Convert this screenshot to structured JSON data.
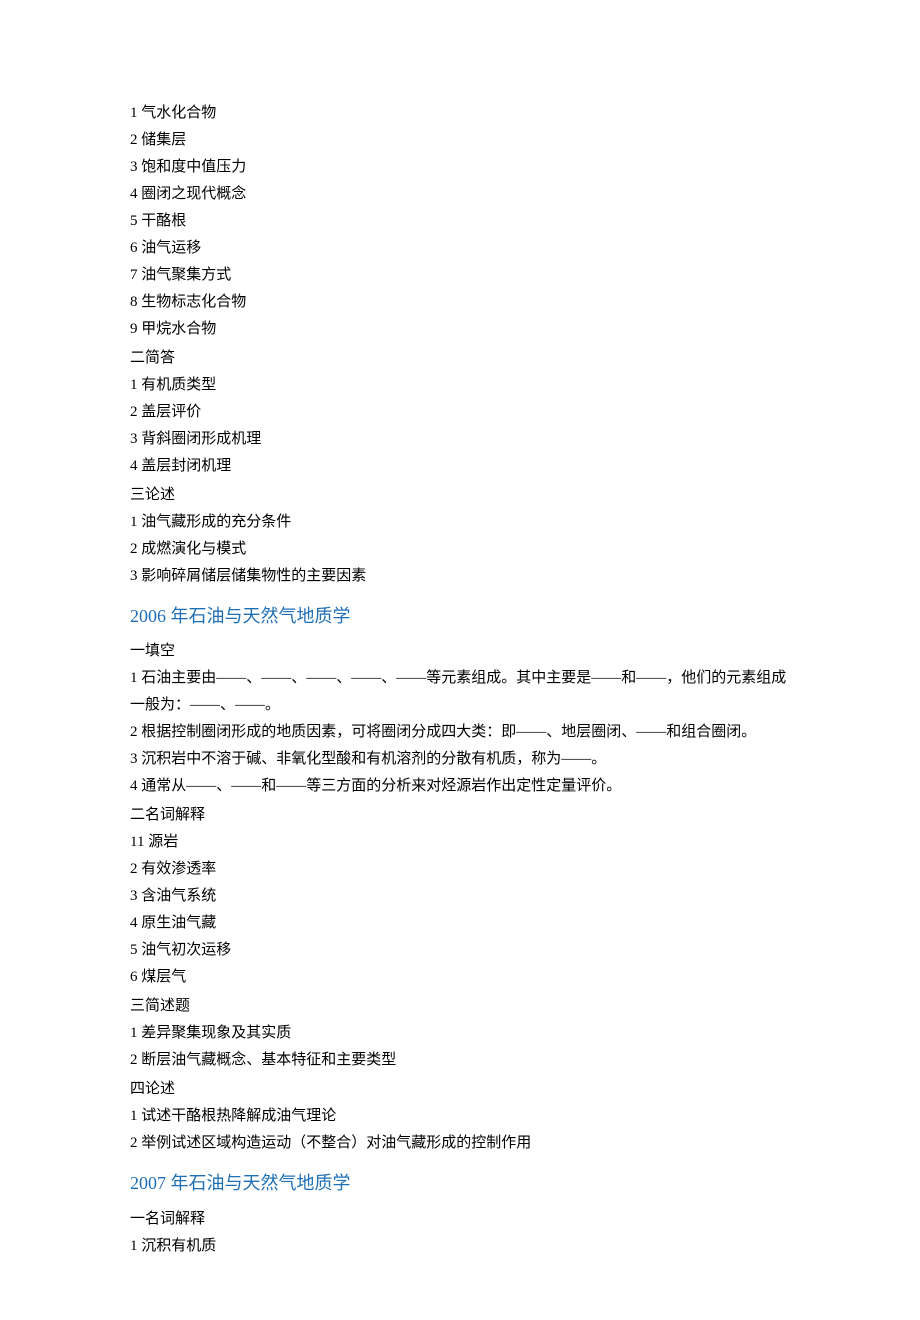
{
  "block1": {
    "items": [
      "1 气水化合物",
      "2 储集层",
      "3 饱和度中值压力",
      "4 圈闭之现代概念",
      "5 干酪根",
      "6 油气运移",
      "7 油气聚集方式",
      "8 生物标志化合物",
      "9 甲烷水合物"
    ],
    "subhead2": "二简答",
    "items2": [
      "1 有机质类型",
      "2 盖层评价",
      "3 背斜圈闭形成机理",
      "4 盖层封闭机理"
    ],
    "subhead3": "三论述",
    "items3": [
      "1 油气藏形成的充分条件",
      "2 成燃演化与模式",
      "3 影响碎屑储层储集物性的主要因素"
    ]
  },
  "heading2006": "2006 年石油与天然气地质学",
  "block2": {
    "subhead1": "一填空",
    "items1": [
      "1 石油主要由——、——、——、——、——等元素组成。其中主要是——和——，他们的元素组成一般为：——、——。",
      "2 根据控制圈闭形成的地质因素，可将圈闭分成四大类：即——、地层圈闭、——和组合圈闭。",
      "3 沉积岩中不溶于碱、非氧化型酸和有机溶剂的分散有机质，称为——。",
      "4 通常从——、——和——等三方面的分析来对烃源岩作出定性定量评价。"
    ],
    "subhead2": "二名词解释",
    "items2": [
      "11 源岩",
      "2 有效渗透率",
      "3 含油气系统",
      "4 原生油气藏",
      "5 油气初次运移",
      "6 煤层气"
    ],
    "subhead3": "三简述题",
    "items3": [
      "1 差异聚集现象及其实质",
      "2 断层油气藏概念、基本特征和主要类型"
    ],
    "subhead4": "四论述",
    "items4": [
      "1 试述干酪根热降解成油气理论",
      "2 举例试述区域构造运动（不整合）对油气藏形成的控制作用"
    ]
  },
  "heading2007": "2007 年石油与天然气地质学",
  "block3": {
    "subhead1": "一名词解释",
    "items1": [
      "1 沉积有机质"
    ]
  }
}
